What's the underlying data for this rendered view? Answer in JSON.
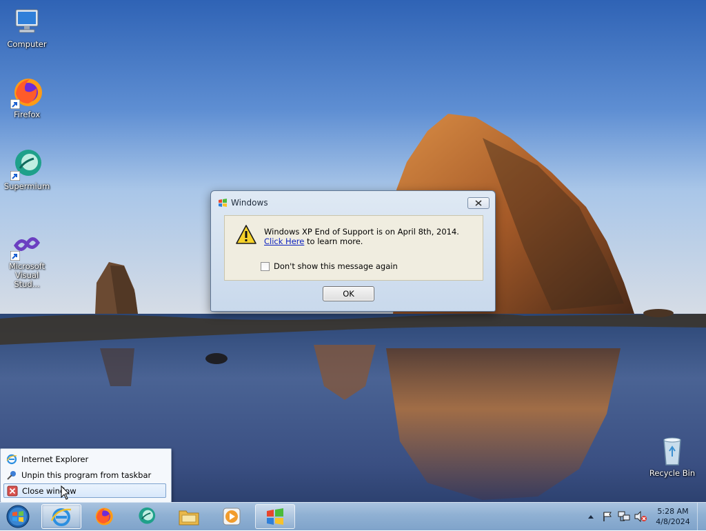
{
  "desktop": {
    "icons": [
      {
        "label": "Computer",
        "icon": "computer-icon"
      },
      {
        "label": "Firefox",
        "icon": "firefox-icon"
      },
      {
        "label": "Supermium",
        "icon": "supermium-icon"
      },
      {
        "label": "Microsoft Visual Stud...",
        "icon": "visual-studio-icon"
      },
      {
        "label": "Recycle Bin",
        "icon": "recycle-bin-icon"
      }
    ]
  },
  "dialog": {
    "title": "Windows",
    "message_before_link": "Windows XP End of Support is on April 8th, 2014. ",
    "link_text": "Click Here",
    "message_after_link": " to learn more.",
    "checkbox_label": "Don't show this message again",
    "checkbox_checked": false,
    "ok_label": "OK"
  },
  "jumplist": {
    "items": [
      {
        "label": "Internet Explorer",
        "icon": "ie-icon"
      },
      {
        "label": "Unpin this program from taskbar",
        "icon": "unpin-icon"
      },
      {
        "label": "Close window",
        "icon": "close-window-icon"
      }
    ]
  },
  "taskbar": {
    "buttons": [
      {
        "name": "Internet Explorer",
        "icon": "ie-icon"
      },
      {
        "name": "Firefox",
        "icon": "firefox-icon"
      },
      {
        "name": "Supermium",
        "icon": "supermium-icon"
      },
      {
        "name": "Windows Explorer",
        "icon": "folder-icon"
      },
      {
        "name": "Windows Media Player",
        "icon": "media-player-icon"
      },
      {
        "name": "Windows",
        "icon": "windows-flag-icon"
      }
    ],
    "clock": {
      "time": "5:28 AM",
      "date": "4/8/2024"
    }
  },
  "colors": {
    "taskbar": "#8fb0d3",
    "dialog_body": "#f0ede0",
    "link": "#0a1fbf"
  }
}
